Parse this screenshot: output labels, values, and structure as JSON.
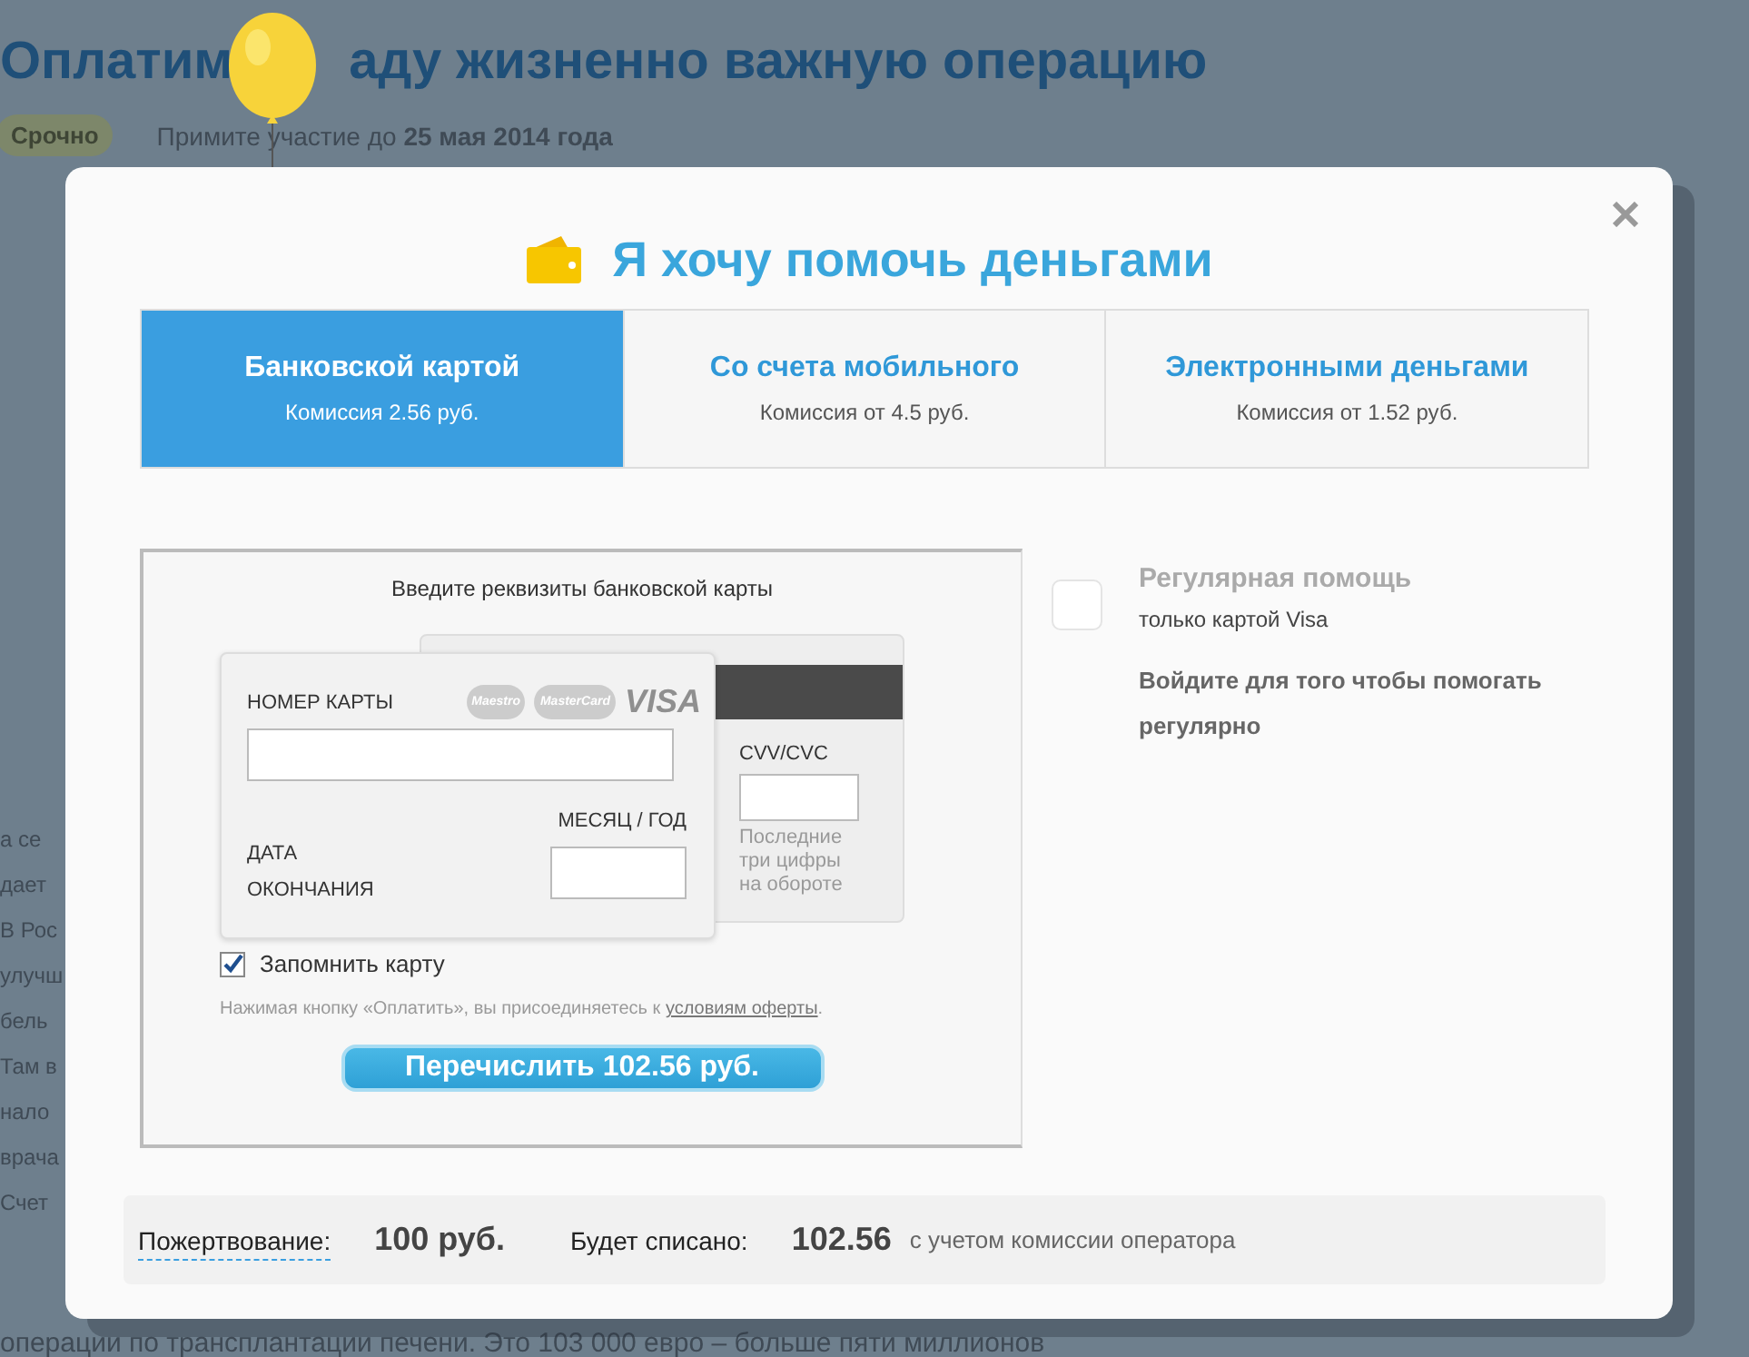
{
  "background": {
    "title_parts": [
      "Оплатим",
      "аду жизненно важную операцию"
    ],
    "badge": "Срочно",
    "deadline": "Примите участие до **25 мая 2014 года**",
    "fragments": [
      "а се",
      "дает",
      "В Рос",
      "улучш",
      "бель",
      "Там в",
      "нало",
      "врача",
      "Счет"
    ],
    "bottom_line": "операции по трансплантации печени. Это 103 000 евро – больше пяти миллионов"
  },
  "modal": {
    "title": "Я хочу помочь деньгами",
    "tabs": [
      {
        "label": "Банковской картой",
        "commission": "Комиссия 2.56 руб.",
        "selected": true
      },
      {
        "label": "Со счета мобильного",
        "commission": "Комиссия от 4.5 руб.",
        "selected": false
      },
      {
        "label": "Электронными деньгами",
        "commission": "Комиссия от 1.52 руб.",
        "selected": false
      }
    ],
    "form": {
      "heading": "Введите реквизиты банковской карты",
      "card_number_label": "НОМЕР КАРТЫ",
      "brands": [
        "Maestro",
        "MasterCard",
        "VISA"
      ],
      "expiry_label": "ДАТА ОКОНЧАНИЯ",
      "month_year_label": "МЕСЯЦ / ГОД",
      "cvv_label": "CVV/CVC",
      "cvv_hint": "Последние три цифры на обороте",
      "remember": {
        "label": "Запомнить карту",
        "checked": true
      },
      "terms_text": "Нажимая кнопку «Оплатить», вы присоединяетесь к ",
      "terms_link": "условиям оферты",
      "terms_end": ".",
      "submit": "Перечислить 102.56 руб."
    },
    "regular": {
      "checked": false,
      "title": "Регулярная помощь",
      "subtitle": "только картой Visa",
      "login_note": "Войдите для того чтобы помогать регулярно"
    },
    "summary": {
      "donation_label": "Пожертвование:",
      "donation_amount": "100 руб.",
      "charged_label": "Будет списано:",
      "charged_amount": "102.56",
      "note": "с учетом комиссии оператора"
    }
  }
}
